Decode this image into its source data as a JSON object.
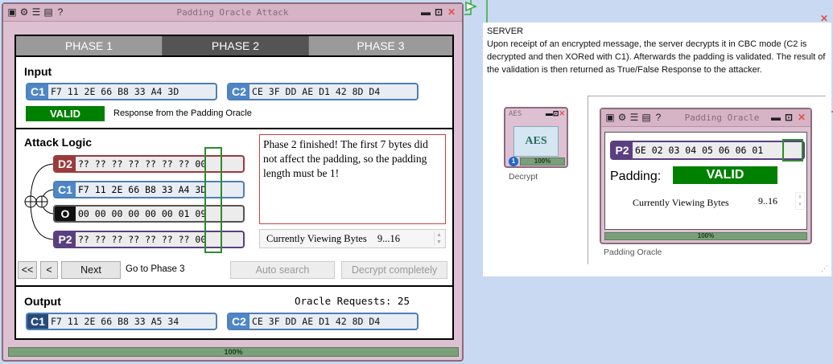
{
  "main_window": {
    "title": "Padding Oracle Attack",
    "tabs": [
      {
        "label": "PHASE 1",
        "active": false
      },
      {
        "label": "PHASE 2",
        "active": true
      },
      {
        "label": "PHASE 3",
        "active": false
      }
    ],
    "input": {
      "heading": "Input",
      "c1": {
        "tag": "C1",
        "bytes": "F7 11 2E 66 B8 33 A4 3D"
      },
      "c2": {
        "tag": "C2",
        "bytes": "CE 3F DD AE D1 42 8D D4"
      },
      "validity": "VALID",
      "validity_note": "Response from the Padding Oracle"
    },
    "attack": {
      "heading": "Attack Logic",
      "rows": [
        {
          "tag": "D2",
          "bytes": "?? ?? ?? ?? ?? ?? ?? 00",
          "color": "#9b3a3a"
        },
        {
          "tag": "C1",
          "bytes": "F7 11 2E 66 B8 33 A4 3D",
          "color": "#4e86c7"
        },
        {
          "tag": "O",
          "bytes": "00 00 00 00 00 00 01 09",
          "color": "#111111"
        },
        {
          "tag": "P2",
          "bytes": "?? ?? ?? ?? ?? ?? ?? 00",
          "color": "#5a3f80"
        }
      ],
      "message": "Phase 2 finished! The first 7 bytes did not affect the padding, so the padding length must be 1!",
      "viewing_label": "Currently Viewing Bytes",
      "viewing_value": "9...16"
    },
    "controls": {
      "first": "<<",
      "prev": "<",
      "next": "Next",
      "hint": "Go to Phase 3",
      "auto": "Auto search",
      "decrypt": "Decrypt completely"
    },
    "output": {
      "heading": "Output",
      "requests": "Oracle Requests: 25",
      "c1": {
        "tag": "C1",
        "bytes": "F7 11 2E 66 B8 33 A5 34"
      },
      "c2": {
        "tag": "C2",
        "bytes": "CE 3F DD AE D1 42 8D D4"
      }
    },
    "progress": "100%"
  },
  "server_note": {
    "title": "SERVER",
    "body": "Upon receipt of an encrypted message, the server decrypts it in CBC mode (C2 is decrypted and then XORed with C1). Afterwards the padding is validated. The result of the validation is then returned as True/False Response to the attacker."
  },
  "aes_component": {
    "title": "AES",
    "icon_text": "AES",
    "badge": "1",
    "progress": "100%",
    "caption": "Decrypt"
  },
  "oracle_window": {
    "title": "Padding Oracle",
    "p2": {
      "tag": "P2",
      "bytes": "6E 02 03 04 05 06 06 01"
    },
    "padding_label": "Padding:",
    "padding_value": "VALID",
    "viewing_label": "Currently Viewing Bytes",
    "viewing_value": "9..16",
    "progress": "100%",
    "caption": "Padding Oracle"
  },
  "colors": {
    "accent_green": "#008000",
    "window_pink": "#ddc1d2",
    "block_blue": "#4e86c7"
  }
}
